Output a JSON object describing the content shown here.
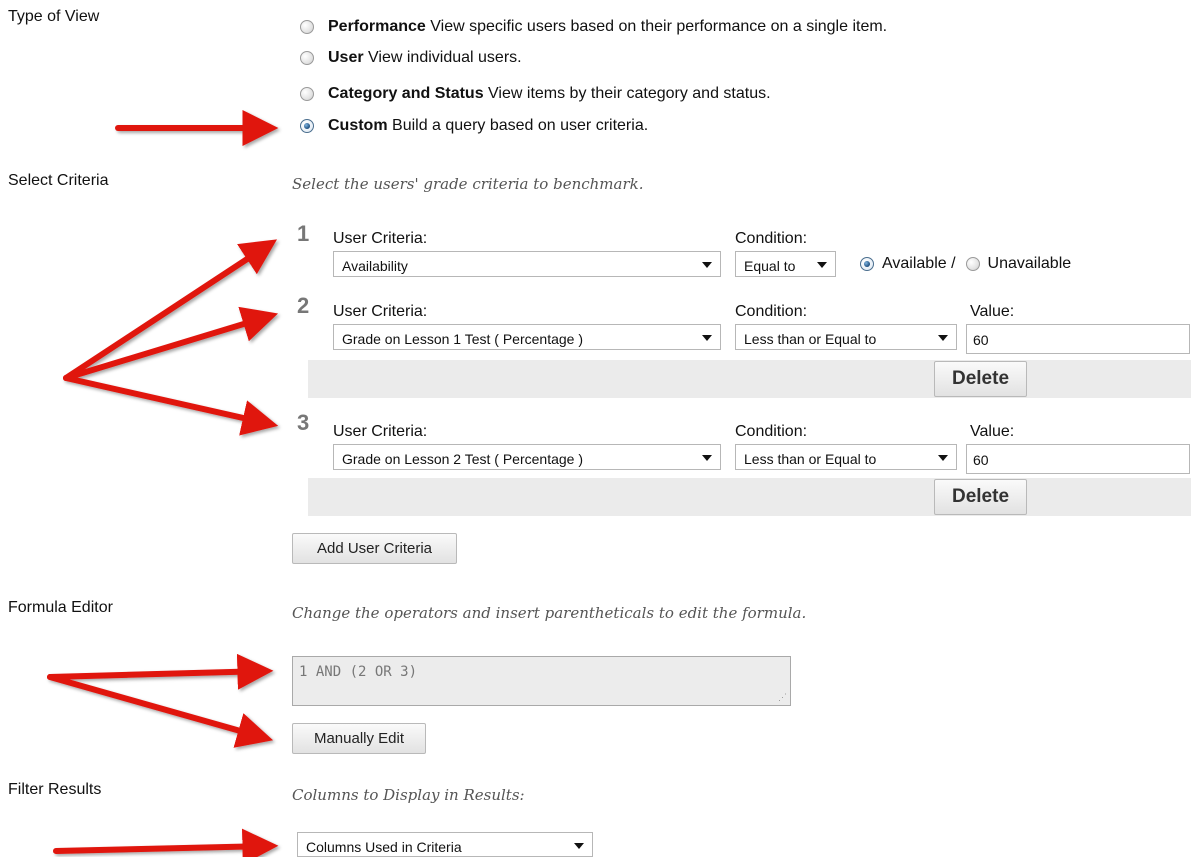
{
  "type_of_view": {
    "label": "Type of View",
    "options": [
      {
        "title": "Performance",
        "desc": "View specific users based on their performance on a single item.",
        "selected": false
      },
      {
        "title": "User",
        "desc": "View individual users.",
        "selected": false
      },
      {
        "title": "Category and Status",
        "desc": "View items by their category and status.",
        "selected": false
      },
      {
        "title": "Custom",
        "desc": "Build a query based on user criteria.",
        "selected": true
      }
    ]
  },
  "select_criteria": {
    "label": "Select Criteria",
    "instruction": "Select the users' grade criteria to benchmark.",
    "user_criteria_label": "User Criteria:",
    "condition_label": "Condition:",
    "value_label": "Value:",
    "rows": [
      {
        "num": "1",
        "criteria": "Availability",
        "condition": "Equal to",
        "available_label": "Available /",
        "unavailable_label": "Unavailable",
        "available_selected": true
      },
      {
        "num": "2",
        "criteria": "Grade on Lesson 1 Test ( Percentage )",
        "condition": "Less than or Equal to",
        "value": "60",
        "delete_label": "Delete"
      },
      {
        "num": "3",
        "criteria": "Grade on Lesson 2 Test ( Percentage )",
        "condition": "Less than or Equal to",
        "value": "60",
        "delete_label": "Delete"
      }
    ],
    "add_button": "Add User Criteria"
  },
  "formula_editor": {
    "label": "Formula Editor",
    "instruction": "Change the operators and insert parentheticals to edit the formula.",
    "formula": "1 AND (2 OR 3)",
    "manual_edit_button": "Manually Edit"
  },
  "filter_results": {
    "label": "Filter Results",
    "instruction": "Columns to Display in Results:",
    "columns_select": "Columns Used in Criteria"
  },
  "colors": {
    "annotation_arrow": "#e0140f",
    "radio_selected": "#1d4e7e",
    "bar_background": "#ebebeb"
  }
}
